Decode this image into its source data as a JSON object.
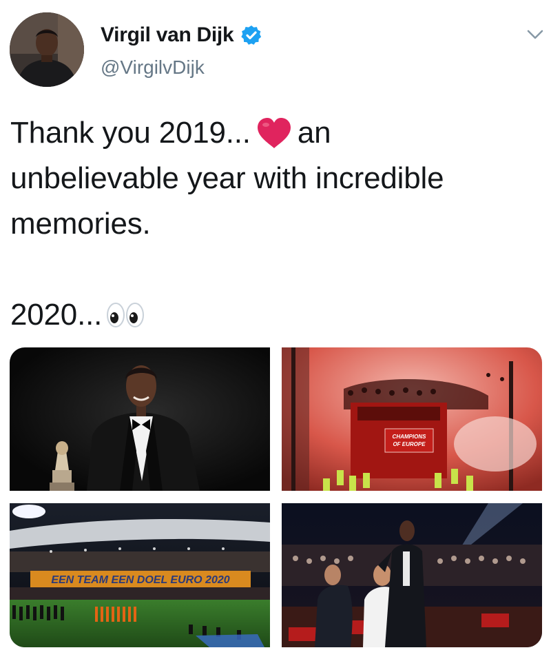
{
  "author": {
    "name": "Virgil van Dijk",
    "handle": "@VirgilvDijk",
    "verified": true,
    "verified_icon": "verified-badge-icon",
    "verified_color": "#1da1f2"
  },
  "menu": {
    "icon": "chevron-down-icon"
  },
  "tweet": {
    "line1_before": "Thank you 2019...",
    "line1_after": "an",
    "line2": "unbelievable year with incredible",
    "line3": "memories.",
    "line4": "2020...",
    "emoji_heart": "red-heart-icon",
    "emoji_eyes": "eyes-icon"
  },
  "media": {
    "photos": [
      {
        "subject": "award-photo",
        "trophy_icon": "trophy-icon"
      },
      {
        "subject": "parade-photo",
        "bus_sign": "CHAMPIONS OF EUROPE"
      },
      {
        "subject": "stadium-photo",
        "banner": "EEN TEAM  EEN DOEL  EURO 2020"
      },
      {
        "subject": "ceremony-photo"
      }
    ]
  },
  "colors": {
    "text": "#14171a",
    "secondary": "#657786",
    "heart": "#e0245e",
    "accent": "#1da1f2"
  }
}
